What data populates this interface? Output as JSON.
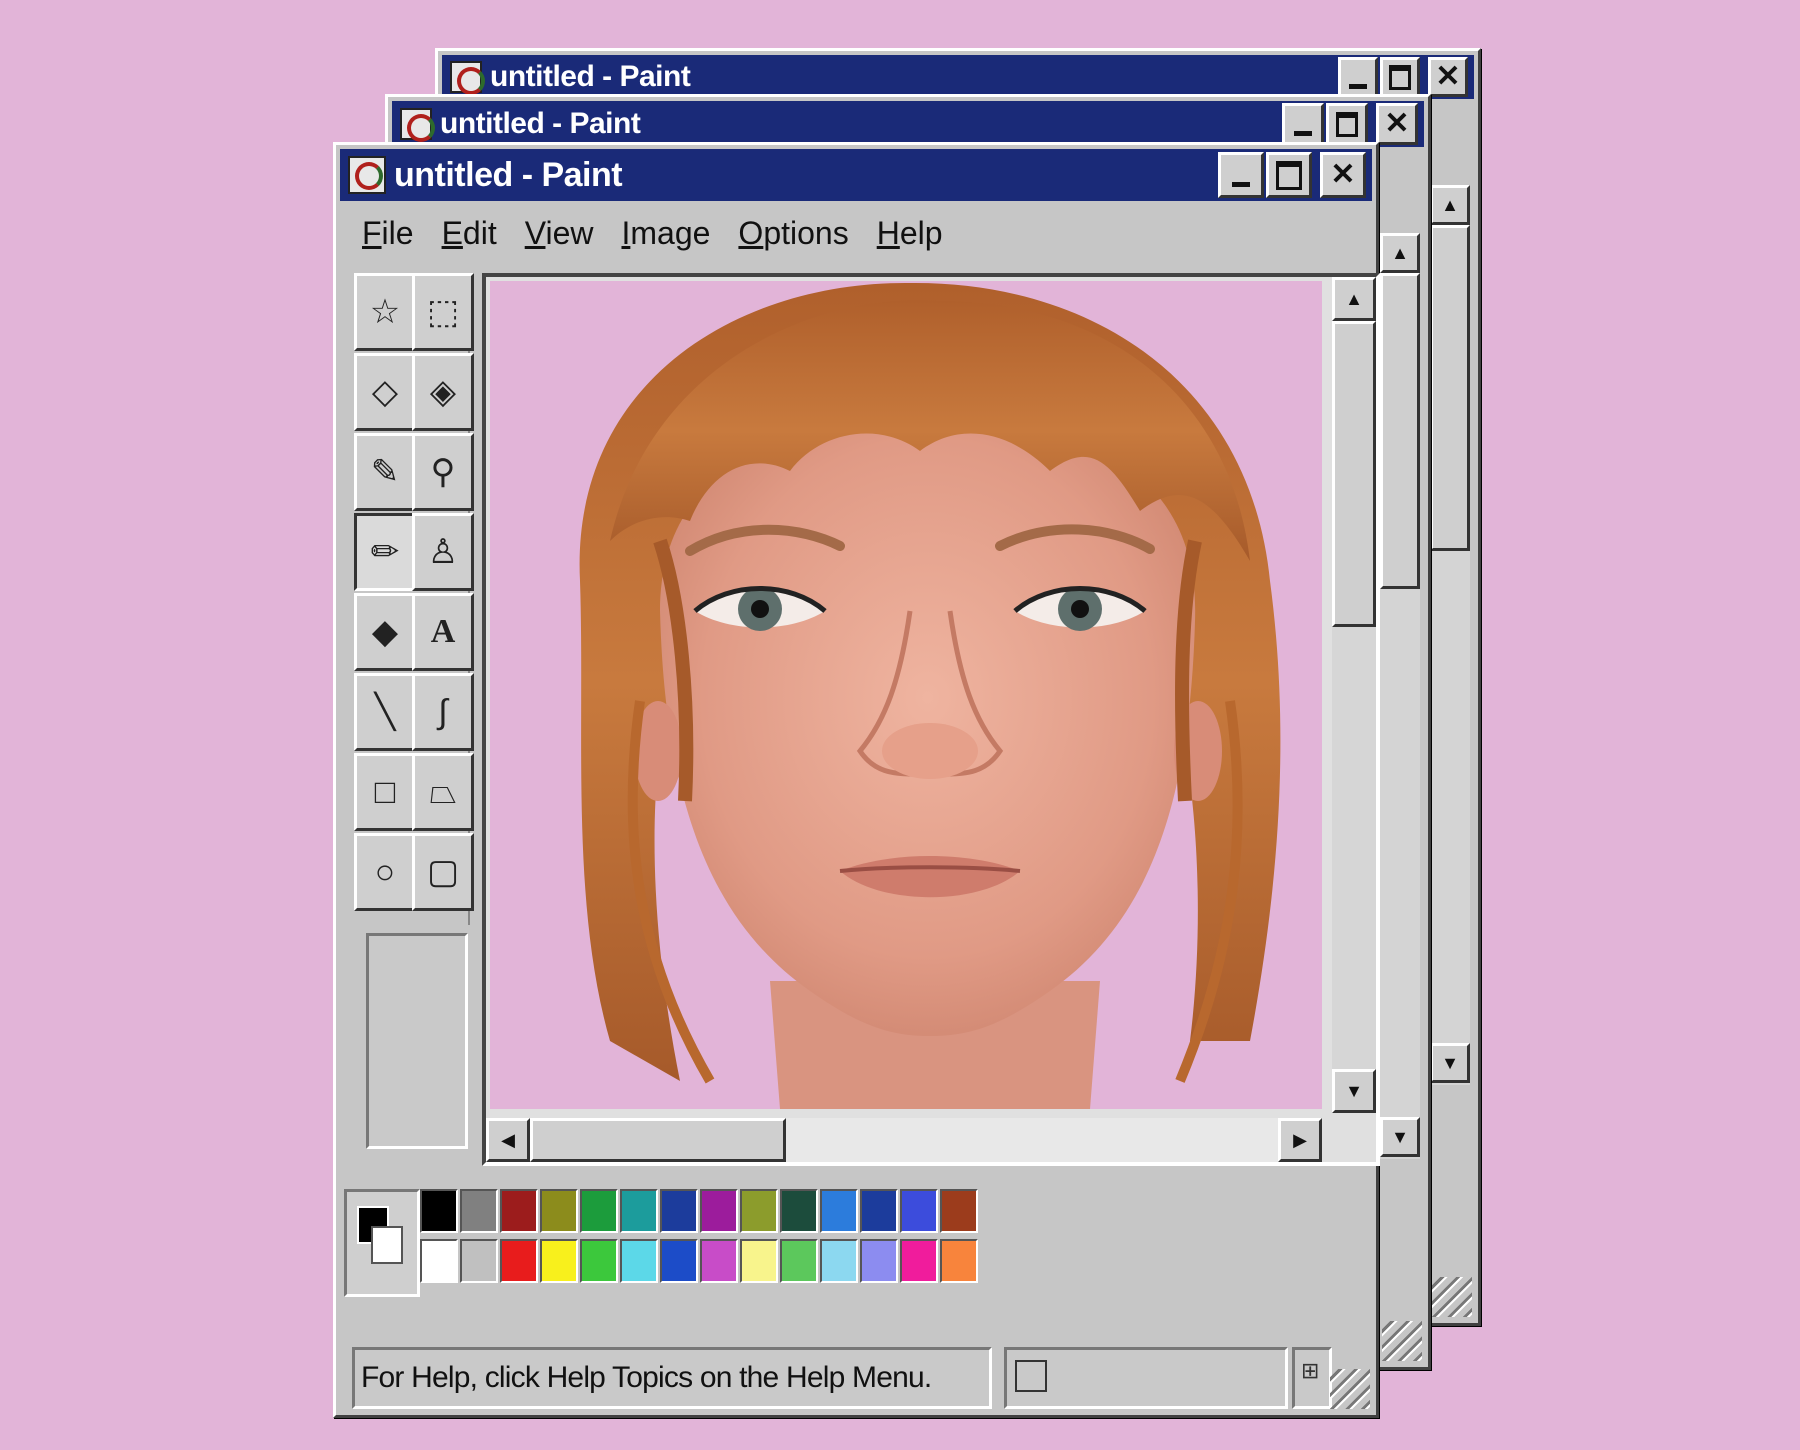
{
  "windows": [
    {
      "title": "untitled - Paint"
    },
    {
      "title": "untitled - Paint"
    },
    {
      "title": "untitled - Paint"
    }
  ],
  "menu": [
    {
      "first": "F",
      "rest": "ile"
    },
    {
      "first": "E",
      "rest": "dit"
    },
    {
      "first": "V",
      "rest": "iew"
    },
    {
      "first": "I",
      "rest": "mage"
    },
    {
      "first": "O",
      "rest": "ptions"
    },
    {
      "first": "H",
      "rest": "elp"
    }
  ],
  "tools": [
    {
      "name": "free-form-select-icon",
      "glyph": "☆"
    },
    {
      "name": "select-icon",
      "glyph": "⬚"
    },
    {
      "name": "eraser-icon",
      "glyph": "◇"
    },
    {
      "name": "fill-icon",
      "glyph": "◈"
    },
    {
      "name": "pick-color-icon",
      "glyph": "✎"
    },
    {
      "name": "magnifier-icon",
      "glyph": "⚲"
    },
    {
      "name": "pencil-icon",
      "glyph": "✏"
    },
    {
      "name": "brush-icon",
      "glyph": "♙"
    },
    {
      "name": "airbrush-icon",
      "glyph": "◆"
    },
    {
      "name": "text-icon",
      "glyph": "A"
    },
    {
      "name": "line-icon",
      "glyph": "╲"
    },
    {
      "name": "curve-icon",
      "glyph": "∫"
    },
    {
      "name": "rectangle-icon",
      "glyph": "□"
    },
    {
      "name": "polygon-icon",
      "glyph": "⏢"
    },
    {
      "name": "ellipse-icon",
      "glyph": "○"
    },
    {
      "name": "rounded-rectangle-icon",
      "glyph": "▢"
    }
  ],
  "active_tool": "pencil-icon",
  "palette": {
    "foreground": "#000000",
    "background": "#ffffff",
    "top_row": [
      "#000000",
      "#808080",
      "#9c1c1c",
      "#8c8c1c",
      "#1c9c3c",
      "#1c9c9c",
      "#1c3c9c",
      "#9c1c9c",
      "#8c9c2c",
      "#1c4c3c",
      "#2c7cdc",
      "#1c3c9c",
      "#3c4cdc",
      "#9c3c1c"
    ],
    "bottom_row": [
      "#ffffff",
      "#c0c0c0",
      "#e81c1c",
      "#f8f01c",
      "#3cc83c",
      "#5cd8e8",
      "#1c4cc8",
      "#c84cc8",
      "#f8f48c",
      "#5cc85c",
      "#8cd8f0",
      "#8c8cf0",
      "#f01c9c",
      "#f8843c"
    ]
  },
  "status": {
    "text": "For Help, click Help Topics on the Help Menu."
  },
  "icons": {
    "minimize": "minimize-icon",
    "maximize": "maximize-icon",
    "close": "close-icon",
    "scroll_up": "▲",
    "scroll_down": "▼",
    "scroll_left": "◀",
    "scroll_right": "▶"
  }
}
